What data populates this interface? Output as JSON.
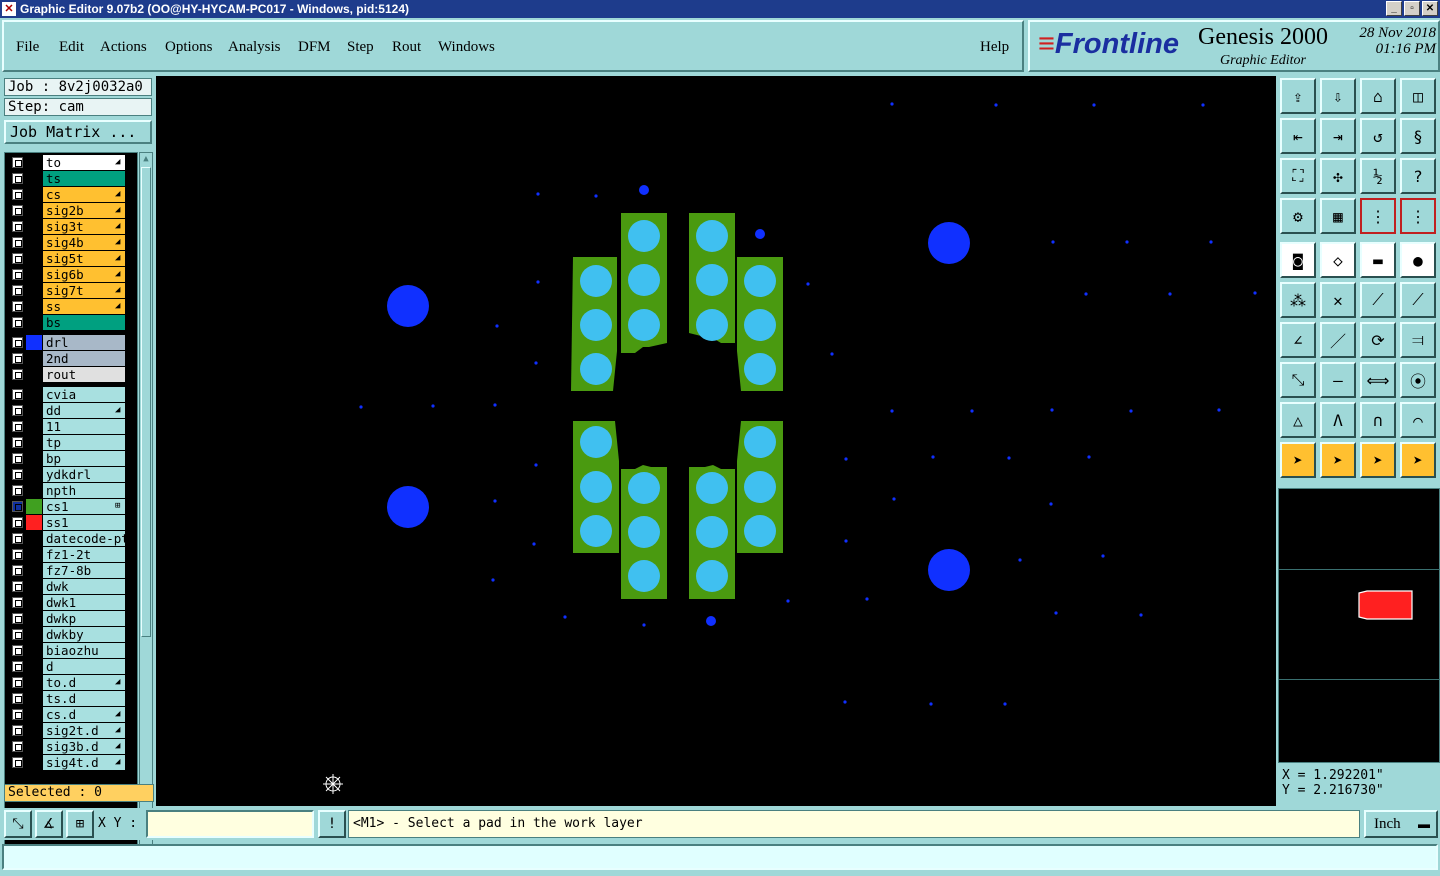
{
  "window": {
    "title": "Graphic Editor 9.07b2 (OO@HY-HYCAM-PC017 - Windows, pid:5124)"
  },
  "menu": [
    "File",
    "Edit",
    "Actions",
    "Options",
    "Analysis",
    "DFM",
    "Step",
    "Rout",
    "Windows"
  ],
  "help": "Help",
  "brand": {
    "logo": "Frontline",
    "product": "Genesis 2000",
    "subtitle": "Graphic Editor",
    "date": "28 Nov 2018",
    "time": "01:16 PM"
  },
  "job": {
    "label": "Job : 8v2j0032a0",
    "step": "Step: cam",
    "matrix_button": "Job Matrix ..."
  },
  "layers": [
    {
      "name": "to",
      "color": "#ffffff",
      "flag": "◢"
    },
    {
      "name": "ts",
      "color": "#00a080",
      "flag": ""
    },
    {
      "name": "cs",
      "color": "#ffc030",
      "flag": "◢"
    },
    {
      "name": "sig2b",
      "color": "#ffc030",
      "flag": "◢"
    },
    {
      "name": "sig3t",
      "color": "#ffc030",
      "flag": "◢"
    },
    {
      "name": "sig4b",
      "color": "#ffc030",
      "flag": "◢"
    },
    {
      "name": "sig5t",
      "color": "#ffc030",
      "flag": "◢"
    },
    {
      "name": "sig6b",
      "color": "#ffc030",
      "flag": "◢"
    },
    {
      "name": "sig7t",
      "color": "#ffc030",
      "flag": "◢"
    },
    {
      "name": "ss",
      "color": "#ffc030",
      "flag": "◢"
    },
    {
      "name": "bs",
      "color": "#00a080",
      "flag": ""
    },
    {
      "name": "drl",
      "color": "#a8b8c8",
      "flag": "",
      "swatch": "#1030ff"
    },
    {
      "name": "2nd",
      "color": "#a8b8c8",
      "flag": ""
    },
    {
      "name": "rout",
      "color": "#e0e0e0",
      "flag": ""
    },
    {
      "name": "cvia",
      "color": "#a8e0e0",
      "flag": ""
    },
    {
      "name": "dd",
      "color": "#a8e0e0",
      "flag": "◢"
    },
    {
      "name": "11",
      "color": "#a8e0e0",
      "flag": ""
    },
    {
      "name": "tp",
      "color": "#a8e0e0",
      "flag": ""
    },
    {
      "name": "bp",
      "color": "#a8e0e0",
      "flag": ""
    },
    {
      "name": "ydkdrl",
      "color": "#a8e0e0",
      "flag": ""
    },
    {
      "name": "npth",
      "color": "#a8e0e0",
      "flag": ""
    },
    {
      "name": "cs1",
      "color": "#a8e0e0",
      "flag": "⊞",
      "swatch": "#40a020",
      "active": true
    },
    {
      "name": "ss1",
      "color": "#a8e0e0",
      "flag": "",
      "swatch": "#ff2020"
    },
    {
      "name": "datecode-ptc",
      "color": "#a8e0e0",
      "flag": ""
    },
    {
      "name": "fz1-2t",
      "color": "#a8e0e0",
      "flag": ""
    },
    {
      "name": "fz7-8b",
      "color": "#a8e0e0",
      "flag": ""
    },
    {
      "name": "dwk",
      "color": "#a8e0e0",
      "flag": ""
    },
    {
      "name": "dwk1",
      "color": "#a8e0e0",
      "flag": ""
    },
    {
      "name": "dwkp",
      "color": "#a8e0e0",
      "flag": ""
    },
    {
      "name": "dwkby",
      "color": "#a8e0e0",
      "flag": ""
    },
    {
      "name": "biaozhu",
      "color": "#a8e0e0",
      "flag": ""
    },
    {
      "name": "d",
      "color": "#a8e0e0",
      "flag": ""
    },
    {
      "name": "to.d",
      "color": "#a8e0e0",
      "flag": "◢"
    },
    {
      "name": "ts.d",
      "color": "#a8e0e0",
      "flag": ""
    },
    {
      "name": "cs.d",
      "color": "#a8e0e0",
      "flag": "◢"
    },
    {
      "name": "sig2t.d",
      "color": "#a8e0e0",
      "flag": "◢"
    },
    {
      "name": "sig3b.d",
      "color": "#a8e0e0",
      "flag": "◢"
    },
    {
      "name": "sig4t.d",
      "color": "#a8e0e0",
      "flag": "◢"
    }
  ],
  "selected": "Selected : 0",
  "coords": {
    "x": "X = 1.292201\"",
    "y": "Y = 2.216730\""
  },
  "bottom": {
    "xy_label": "X Y :",
    "xy_value": "",
    "prompt": "<M1> - Select a pad in the work layer",
    "unit": "Inch"
  },
  "colors": {
    "pad_green": "#4a9a10",
    "pad_cyan": "#40c0f0",
    "drill_blue": "#1030ff",
    "panel": "#9fd8d8"
  }
}
